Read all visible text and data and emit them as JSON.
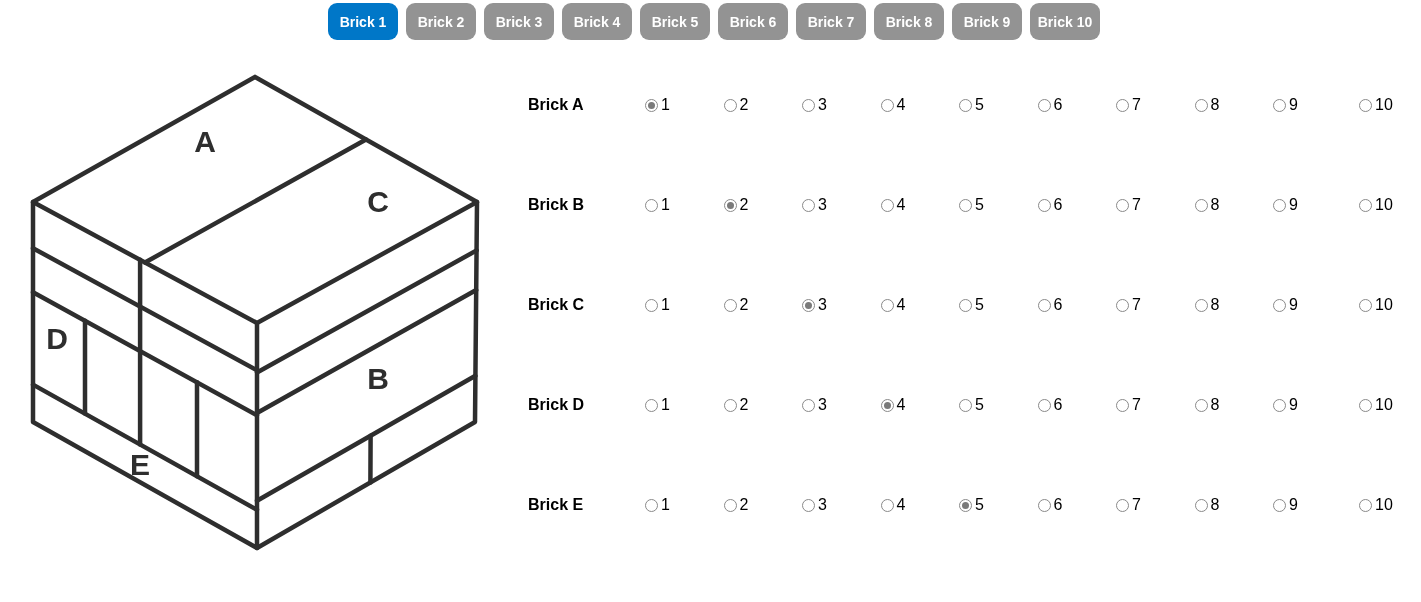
{
  "tabs": [
    {
      "label": "Brick 1",
      "selected": true
    },
    {
      "label": "Brick 2",
      "selected": false
    },
    {
      "label": "Brick 3",
      "selected": false
    },
    {
      "label": "Brick 4",
      "selected": false
    },
    {
      "label": "Brick 5",
      "selected": false
    },
    {
      "label": "Brick 6",
      "selected": false
    },
    {
      "label": "Brick 7",
      "selected": false
    },
    {
      "label": "Brick 8",
      "selected": false
    },
    {
      "label": "Brick 9",
      "selected": false
    },
    {
      "label": "Brick 10",
      "selected": false
    }
  ],
  "figure": {
    "labels": [
      "A",
      "C",
      "D",
      "B",
      "E"
    ]
  },
  "bricks": [
    {
      "label": "Brick A",
      "options": [
        {
          "label": "1",
          "selected": true
        },
        {
          "label": "2",
          "selected": false
        },
        {
          "label": "3",
          "selected": false
        },
        {
          "label": "4",
          "selected": false
        },
        {
          "label": "5",
          "selected": false
        },
        {
          "label": "6",
          "selected": false
        },
        {
          "label": "7",
          "selected": false
        },
        {
          "label": "8",
          "selected": false
        },
        {
          "label": "9",
          "selected": false
        },
        {
          "label": "10",
          "selected": false
        }
      ]
    },
    {
      "label": "Brick B",
      "options": [
        {
          "label": "1",
          "selected": false
        },
        {
          "label": "2",
          "selected": true
        },
        {
          "label": "3",
          "selected": false
        },
        {
          "label": "4",
          "selected": false
        },
        {
          "label": "5",
          "selected": false
        },
        {
          "label": "6",
          "selected": false
        },
        {
          "label": "7",
          "selected": false
        },
        {
          "label": "8",
          "selected": false
        },
        {
          "label": "9",
          "selected": false
        },
        {
          "label": "10",
          "selected": false
        }
      ]
    },
    {
      "label": "Brick C",
      "options": [
        {
          "label": "1",
          "selected": false
        },
        {
          "label": "2",
          "selected": false
        },
        {
          "label": "3",
          "selected": true
        },
        {
          "label": "4",
          "selected": false
        },
        {
          "label": "5",
          "selected": false
        },
        {
          "label": "6",
          "selected": false
        },
        {
          "label": "7",
          "selected": false
        },
        {
          "label": "8",
          "selected": false
        },
        {
          "label": "9",
          "selected": false
        },
        {
          "label": "10",
          "selected": false
        }
      ]
    },
    {
      "label": "Brick D",
      "options": [
        {
          "label": "1",
          "selected": false
        },
        {
          "label": "2",
          "selected": false
        },
        {
          "label": "3",
          "selected": false
        },
        {
          "label": "4",
          "selected": true
        },
        {
          "label": "5",
          "selected": false
        },
        {
          "label": "6",
          "selected": false
        },
        {
          "label": "7",
          "selected": false
        },
        {
          "label": "8",
          "selected": false
        },
        {
          "label": "9",
          "selected": false
        },
        {
          "label": "10",
          "selected": false
        }
      ]
    },
    {
      "label": "Brick E",
      "options": [
        {
          "label": "1",
          "selected": false
        },
        {
          "label": "2",
          "selected": false
        },
        {
          "label": "3",
          "selected": false
        },
        {
          "label": "4",
          "selected": false
        },
        {
          "label": "5",
          "selected": true
        },
        {
          "label": "6",
          "selected": false
        },
        {
          "label": "7",
          "selected": false
        },
        {
          "label": "8",
          "selected": false
        },
        {
          "label": "9",
          "selected": false
        },
        {
          "label": "10",
          "selected": false
        }
      ]
    }
  ]
}
